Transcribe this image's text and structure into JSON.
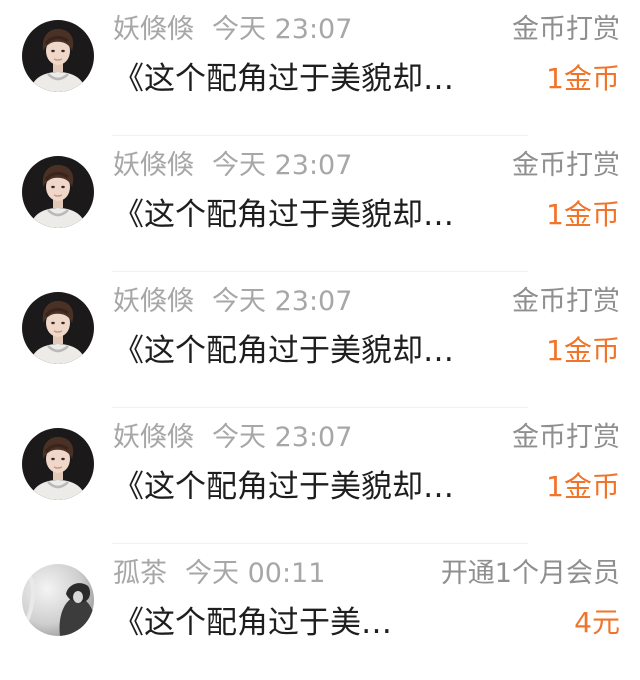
{
  "records": [
    {
      "avatar": "avatar-boy-dark-bg",
      "username": "妖倏倏",
      "time": "今天 23:07",
      "type": "金币打赏",
      "title": "《这个配角过于美貌却…",
      "amount": "1金币"
    },
    {
      "avatar": "avatar-boy-dark-bg",
      "username": "妖倏倏",
      "time": "今天 23:07",
      "type": "金币打赏",
      "title": "《这个配角过于美貌却…",
      "amount": "1金币"
    },
    {
      "avatar": "avatar-boy-dark-bg",
      "username": "妖倏倏",
      "time": "今天 23:07",
      "type": "金币打赏",
      "title": "《这个配角过于美貌却…",
      "amount": "1金币"
    },
    {
      "avatar": "avatar-boy-dark-bg",
      "username": "妖倏倏",
      "time": "今天 23:07",
      "type": "金币打赏",
      "title": "《这个配角过于美貌却…",
      "amount": "1金币"
    },
    {
      "avatar": "avatar-grayscale-figure",
      "username": "孤茶",
      "time": "今天 00:11",
      "type": "开通1个月会员",
      "title": "《这个配角过于美…",
      "amount": "4元"
    }
  ],
  "colors": {
    "amount": "#f0752b",
    "meta_text": "#a7a7a7",
    "type_text": "#8f8f8f",
    "title_text": "#1e1e1e"
  }
}
